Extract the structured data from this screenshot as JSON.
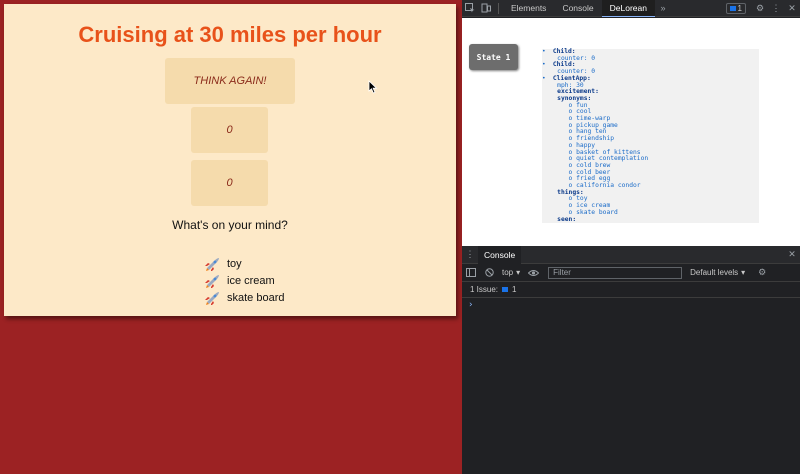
{
  "app": {
    "title": "Cruising at 30 miles per hour",
    "think_button": "THINK AGAIN!",
    "counters": [
      "0",
      "0"
    ],
    "prompt": "What's on your mind?",
    "things": [
      "toy",
      "ice cream",
      "skate board"
    ]
  },
  "devtools": {
    "tabs": [
      "Elements",
      "Console",
      "DeLorean"
    ],
    "active_tab": "DeLorean",
    "issue_count": "1",
    "more_tabs": "»",
    "delorean": {
      "state_label": "State 1",
      "tree": {
        "child1_key": "Child:",
        "child1_counter": "counter: 0",
        "child2_key": "Child:",
        "child2_counter": "counter: 0",
        "clientapp_key": "ClientApp:",
        "mph": "mph: 30",
        "excitement": "excitement:",
        "synonyms_key": "synonyms:",
        "synonyms": [
          "fun",
          "cool",
          "time-warp",
          "pickup game",
          "hang ten",
          "friendship",
          "happy",
          "basket of kittens",
          "quiet contemplation",
          "cold brew",
          "cold beer",
          "fried egg",
          "california condor"
        ],
        "things_key": "things:",
        "things": [
          "toy",
          "ice cream",
          "skate board"
        ],
        "seen": "seen:"
      }
    },
    "console": {
      "tab_label": "Console",
      "context": "top",
      "filter_placeholder": "Filter",
      "levels": "Default levels",
      "issues_text": "1 Issue:",
      "issues_count": "1",
      "prompt": "›"
    }
  },
  "colors": {
    "background": "#9c2223",
    "app_panel": "#fde9c8",
    "title": "#e8521a",
    "button_fill": "#f5dbac",
    "devtools_bg": "#202124"
  }
}
